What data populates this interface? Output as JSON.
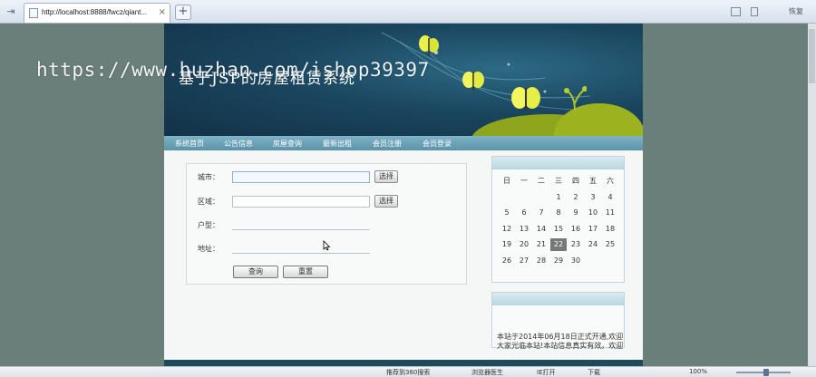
{
  "browser": {
    "tab_title": "http://localhost:8888/fwcz/qiant...",
    "new_tab": "+",
    "close": "×",
    "right_label": "恢复"
  },
  "watermark": "https://www.huzhan.com/ishop39397",
  "site": {
    "title": "基于JSP的房屋租赁系统",
    "nav": [
      "系统首页",
      "公告信息",
      "房屋查询",
      "最新出租",
      "会员注册",
      "会员登录"
    ]
  },
  "search_form": {
    "city_label": "城市：",
    "district_label": "区域：",
    "layout_label": "户型：",
    "address_label": "地址：",
    "select_label": "选择",
    "query_button": "查询",
    "reset_button": "重置"
  },
  "calendar": {
    "weekdays": [
      "日",
      "一",
      "二",
      "三",
      "四",
      "五",
      "六"
    ],
    "rows": [
      [
        "",
        "",
        "",
        "1",
        "2",
        "3",
        "4"
      ],
      [
        "5",
        "6",
        "7",
        "8",
        "9",
        "10",
        "11"
      ],
      [
        "12",
        "13",
        "14",
        "15",
        "16",
        "17",
        "18"
      ],
      [
        "19",
        "20",
        "21",
        "22",
        "23",
        "24",
        "25"
      ],
      [
        "26",
        "27",
        "28",
        "29",
        "30",
        "",
        ""
      ]
    ],
    "today": "22"
  },
  "notice": {
    "text": "本站于2014年06月18日正式开通,欢迎大家光临本站!本站信息真实有效。欢迎"
  },
  "statusbar": {
    "left_item": "推荐到360搜索",
    "browser_item": "浏览器医生",
    "ie_item": "IE打开",
    "download_item": "下载",
    "zoom": "100%"
  }
}
